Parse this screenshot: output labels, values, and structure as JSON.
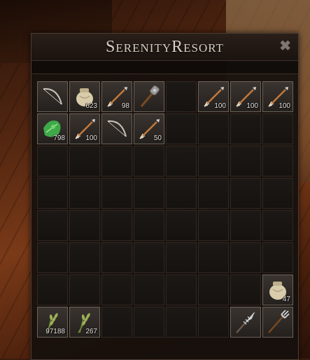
{
  "window": {
    "title": "SerenityResort",
    "close_label": "✖"
  },
  "slots": [
    {
      "icon": "bow-icon",
      "qty": ""
    },
    {
      "icon": "sack-icon",
      "qty": "623"
    },
    {
      "icon": "arrow-icon",
      "qty": "98"
    },
    {
      "icon": "mace-icon",
      "qty": ""
    },
    {
      "icon": "",
      "qty": ""
    },
    {
      "icon": "arrow-icon",
      "qty": "100"
    },
    {
      "icon": "arrow-icon",
      "qty": "100"
    },
    {
      "icon": "arrow-icon",
      "qty": "100"
    },
    {
      "icon": "herb-icon",
      "qty": "798"
    },
    {
      "icon": "arrow-icon",
      "qty": "100"
    },
    {
      "icon": "bow-icon",
      "qty": ""
    },
    {
      "icon": "arrow-icon",
      "qty": "50"
    },
    {
      "icon": "",
      "qty": ""
    },
    {
      "icon": "",
      "qty": ""
    },
    {
      "icon": "",
      "qty": ""
    },
    {
      "icon": "",
      "qty": ""
    },
    {
      "icon": "",
      "qty": ""
    },
    {
      "icon": "",
      "qty": ""
    },
    {
      "icon": "",
      "qty": ""
    },
    {
      "icon": "",
      "qty": ""
    },
    {
      "icon": "",
      "qty": ""
    },
    {
      "icon": "",
      "qty": ""
    },
    {
      "icon": "",
      "qty": ""
    },
    {
      "icon": "",
      "qty": ""
    },
    {
      "icon": "",
      "qty": ""
    },
    {
      "icon": "",
      "qty": ""
    },
    {
      "icon": "",
      "qty": ""
    },
    {
      "icon": "",
      "qty": ""
    },
    {
      "icon": "",
      "qty": ""
    },
    {
      "icon": "",
      "qty": ""
    },
    {
      "icon": "",
      "qty": ""
    },
    {
      "icon": "",
      "qty": ""
    },
    {
      "icon": "",
      "qty": ""
    },
    {
      "icon": "",
      "qty": ""
    },
    {
      "icon": "",
      "qty": ""
    },
    {
      "icon": "",
      "qty": ""
    },
    {
      "icon": "",
      "qty": ""
    },
    {
      "icon": "",
      "qty": ""
    },
    {
      "icon": "",
      "qty": ""
    },
    {
      "icon": "",
      "qty": ""
    },
    {
      "icon": "",
      "qty": ""
    },
    {
      "icon": "",
      "qty": ""
    },
    {
      "icon": "",
      "qty": ""
    },
    {
      "icon": "",
      "qty": ""
    },
    {
      "icon": "",
      "qty": ""
    },
    {
      "icon": "",
      "qty": ""
    },
    {
      "icon": "",
      "qty": ""
    },
    {
      "icon": "",
      "qty": ""
    },
    {
      "icon": "",
      "qty": ""
    },
    {
      "icon": "",
      "qty": ""
    },
    {
      "icon": "",
      "qty": ""
    },
    {
      "icon": "",
      "qty": ""
    },
    {
      "icon": "",
      "qty": ""
    },
    {
      "icon": "",
      "qty": ""
    },
    {
      "icon": "",
      "qty": ""
    },
    {
      "icon": "sack-icon",
      "qty": "47"
    },
    {
      "icon": "wheat-icon",
      "qty": "97188"
    },
    {
      "icon": "wheat-icon",
      "qty": "267"
    },
    {
      "icon": "",
      "qty": ""
    },
    {
      "icon": "",
      "qty": ""
    },
    {
      "icon": "",
      "qty": ""
    },
    {
      "icon": "",
      "qty": ""
    },
    {
      "icon": "serrated-spear-icon",
      "qty": ""
    },
    {
      "icon": "trident-icon",
      "qty": ""
    }
  ]
}
